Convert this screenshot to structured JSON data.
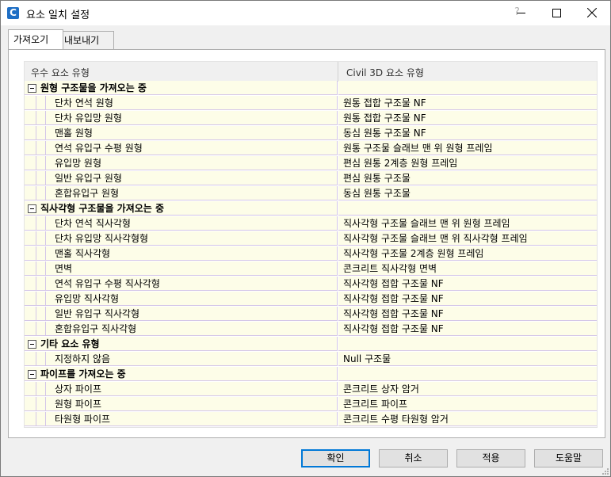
{
  "window": {
    "title": "요소 일치 설정",
    "help_glyph": "?"
  },
  "tabs": [
    {
      "label": "가져오기",
      "active": true
    },
    {
      "label": "내보내기",
      "active": false
    }
  ],
  "grid": {
    "headers": [
      "우수 요소 유형",
      "Civil 3D 요소 유형"
    ],
    "groups": [
      {
        "label": "원형 구조물을 가져오는 중",
        "items": [
          {
            "source": "단차 연석 원형",
            "target": "원통 접합 구조물 NF"
          },
          {
            "source": "단차 유입망 원형",
            "target": "원통 접합 구조물 NF"
          },
          {
            "source": "맨홀 원형",
            "target": "동심 원통 구조물 NF"
          },
          {
            "source": "연석 유입구 수평 원형",
            "target": "원통 구조물 슬래브 맨 위 원형 프레임"
          },
          {
            "source": "유입망 원형",
            "target": "편심 원통 2계층 원형 프레임"
          },
          {
            "source": "일반 유입구 원형",
            "target": "편심 원통 구조물"
          },
          {
            "source": "혼합유입구 원형",
            "target": "동심 원통 구조물"
          }
        ]
      },
      {
        "label": "직사각형 구조물을 가져오는 중",
        "items": [
          {
            "source": "단차 연석 직사각형",
            "target": "직사각형 구조물 슬래브 맨 위 원형 프레임"
          },
          {
            "source": "단차 유입망 직사각형형",
            "target": "직사각형 구조물 슬래브 맨 위 직사각형 프레임"
          },
          {
            "source": "맨홀 직사각형",
            "target": "직사각형 구조물 2계층 원형 프레임"
          },
          {
            "source": "면벽",
            "target": "콘크리트 직사각형 면벽"
          },
          {
            "source": "연석 유입구 수평 직사각형",
            "target": "직사각형 접합 구조물 NF"
          },
          {
            "source": "유입망 직사각형",
            "target": "직사각형 접합 구조물 NF"
          },
          {
            "source": "일반 유입구 직사각형",
            "target": "직사각형 접합 구조물 NF"
          },
          {
            "source": "혼합유입구 직사각형",
            "target": "직사각형 접합 구조물 NF"
          }
        ]
      },
      {
        "label": "기타 요소 유형",
        "items": [
          {
            "source": "지정하지 않음",
            "target": "Null 구조물"
          }
        ]
      },
      {
        "label": "파이프를 가져오는 중",
        "items": [
          {
            "source": "상자 파이프",
            "target": "콘크리트 상자 암거"
          },
          {
            "source": "원형 파이프",
            "target": "콘크리트 파이프"
          },
          {
            "source": "타원형 파이프",
            "target": "콘크리트 수평 타원형 암거"
          }
        ]
      }
    ]
  },
  "buttons": {
    "ok": "확인",
    "cancel": "취소",
    "apply": "적용",
    "help": "도움말"
  }
}
